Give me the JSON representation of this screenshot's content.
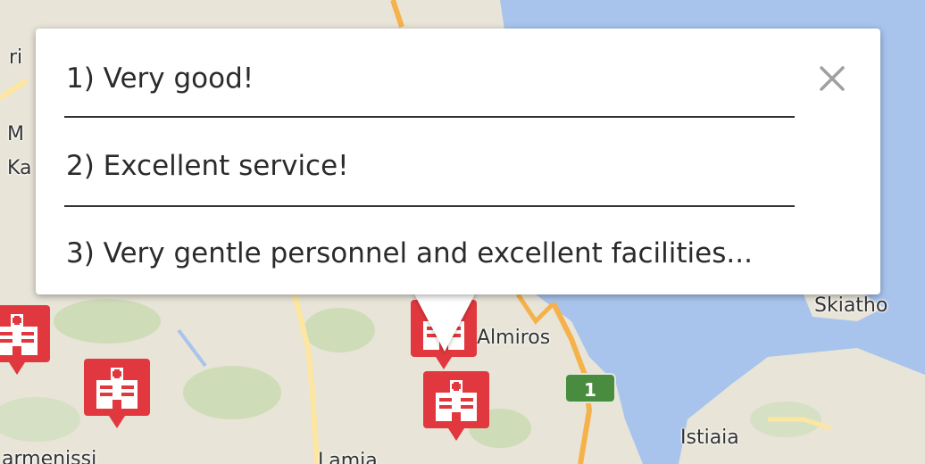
{
  "map": {
    "places": [
      {
        "id": "almiros",
        "name": "Almiros"
      },
      {
        "id": "skiathos",
        "name": "Skiatho"
      },
      {
        "id": "istiaia",
        "name": "Istiaia"
      },
      {
        "id": "left-fragment-1",
        "name": "ri"
      },
      {
        "id": "left-fragment-2",
        "name": "M"
      },
      {
        "id": "left-fragment-3",
        "name": "Ka"
      },
      {
        "id": "bottom-left",
        "name": "armenissi"
      },
      {
        "id": "bottom-mid",
        "name": "Lamia"
      }
    ],
    "route_shield": "1",
    "marker_icon": "hospital-icon",
    "colors": {
      "land": "#e8e4d8",
      "sea": "#a8c4ec",
      "road_major": "#f6b24a",
      "road_minor": "#fde6a0",
      "marker": "#e0383e",
      "shield": "#4a8c3f"
    }
  },
  "popup": {
    "reviews": [
      "1) Very good!",
      "2) Excellent service!",
      "3) Very gentle personnel and excellent facilities..."
    ],
    "close_icon": "close-icon"
  }
}
